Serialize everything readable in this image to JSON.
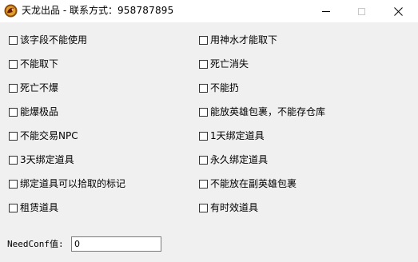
{
  "window": {
    "title_prefix": "天龙出品 - 联系方式：",
    "title_contact": "958787895",
    "minimize_label": "",
    "maximize_label": "",
    "close_label": "✕"
  },
  "checkboxes": {
    "left": [
      {
        "label": "该字段不能使用",
        "checked": false
      },
      {
        "label": "不能取下",
        "checked": false
      },
      {
        "label": "死亡不爆",
        "checked": false
      },
      {
        "label": "能爆极品",
        "checked": false
      },
      {
        "label": "不能交易NPC",
        "checked": false
      },
      {
        "label": "3天绑定道具",
        "checked": false
      },
      {
        "label": "绑定道具可以拾取的标记",
        "checked": false
      },
      {
        "label": "租赁道具",
        "checked": false
      }
    ],
    "right": [
      {
        "label": "用神水才能取下",
        "checked": false
      },
      {
        "label": "死亡消失",
        "checked": false
      },
      {
        "label": "不能扔",
        "checked": false
      },
      {
        "label": "能放英雄包裹，不能存仓库",
        "checked": false
      },
      {
        "label": "1天绑定道具",
        "checked": false
      },
      {
        "label": "永久绑定道具",
        "checked": false
      },
      {
        "label": "不能放在副英雄包裹",
        "checked": false
      },
      {
        "label": "有时效道具",
        "checked": false
      }
    ]
  },
  "needconf": {
    "label": "NeedConf值:",
    "value": "0"
  }
}
